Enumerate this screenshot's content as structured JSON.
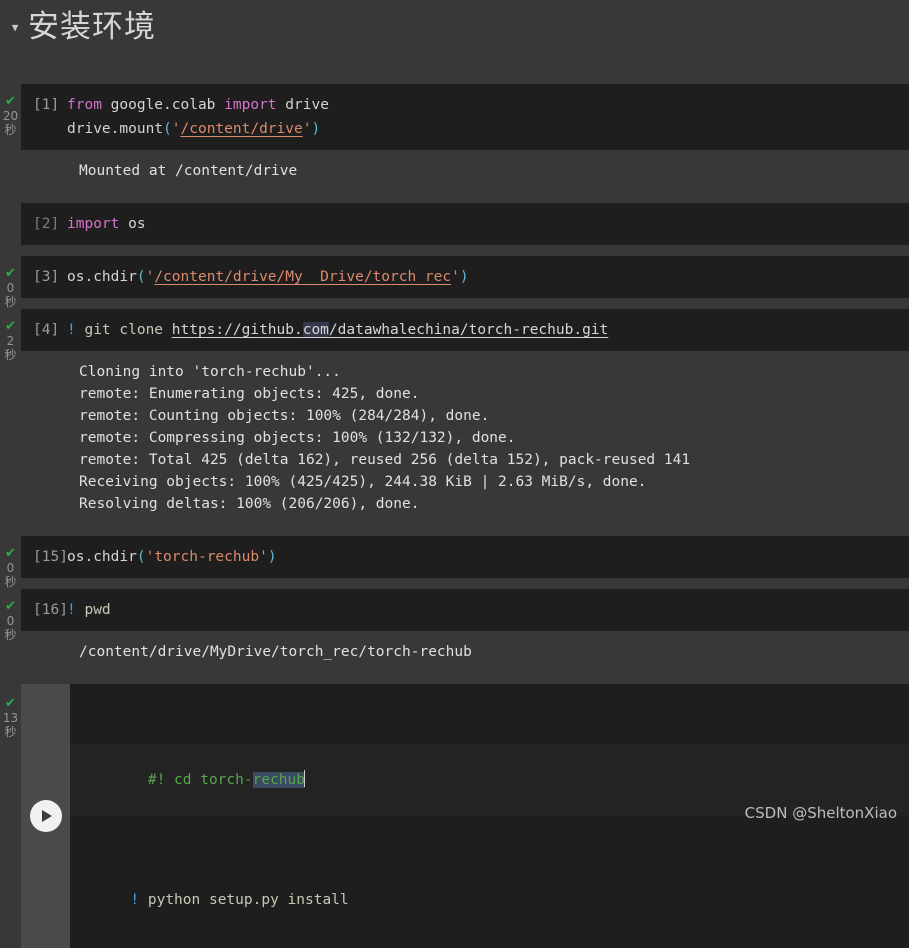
{
  "section": {
    "title": "安装环境",
    "caret": "▼"
  },
  "gutter": {
    "check_glyph": "✔",
    "unit": "秒"
  },
  "cells": [
    {
      "prompt": "[1]",
      "status": "done",
      "time_value": "20",
      "lines": [
        {
          "tokens": [
            {
              "t": "from",
              "c": "tok-kw"
            },
            {
              "t": " ",
              "c": "tok-plain"
            },
            {
              "t": "google.colab",
              "c": "tok-plain"
            },
            {
              "t": " ",
              "c": "tok-plain"
            },
            {
              "t": "import",
              "c": "tok-kw"
            },
            {
              "t": " ",
              "c": "tok-plain"
            },
            {
              "t": "drive",
              "c": "tok-plain"
            }
          ]
        },
        {
          "tokens": [
            {
              "t": "drive.mount",
              "c": "tok-fn"
            },
            {
              "t": "(",
              "c": "tok-punc"
            },
            {
              "t": "'",
              "c": "tok-str"
            },
            {
              "t": "/content/drive",
              "c": "tok-str-link"
            },
            {
              "t": "'",
              "c": "tok-str"
            },
            {
              "t": ")",
              "c": "tok-punc"
            }
          ]
        }
      ],
      "output": [
        "Mounted at /content/drive"
      ]
    },
    {
      "prompt": "[2]",
      "status": "none",
      "time_value": "",
      "lines": [
        {
          "tokens": [
            {
              "t": "import",
              "c": "tok-kw"
            },
            {
              "t": " ",
              "c": "tok-plain"
            },
            {
              "t": "os",
              "c": "tok-plain"
            }
          ]
        }
      ],
      "output": []
    },
    {
      "prompt": "[3]",
      "status": "done",
      "time_value": "0",
      "lines": [
        {
          "tokens": [
            {
              "t": "os.chdir",
              "c": "tok-fn"
            },
            {
              "t": "(",
              "c": "tok-punc"
            },
            {
              "t": "'",
              "c": "tok-str"
            },
            {
              "t": "/content/drive/My  Drive/torch_rec",
              "c": "tok-str-link"
            },
            {
              "t": "'",
              "c": "tok-str"
            },
            {
              "t": ")",
              "c": "tok-punc"
            }
          ]
        }
      ],
      "output": []
    },
    {
      "prompt": "[4]",
      "status": "done",
      "time_value": "2",
      "lines": [
        {
          "tokens": [
            {
              "t": "!",
              "c": "tok-bang"
            },
            {
              "t": " git clone ",
              "c": "tok-name"
            },
            {
              "t": "https://github.",
              "c": "tok-link"
            },
            {
              "t": "com",
              "c": "tok-link hl-soft"
            },
            {
              "t": "/datawhalechina/torch-rechub.git",
              "c": "tok-link"
            }
          ]
        }
      ],
      "output": [
        "Cloning into 'torch-rechub'...",
        "remote: Enumerating objects: 425, done.",
        "remote: Counting objects: 100% (284/284), done.",
        "remote: Compressing objects: 100% (132/132), done.",
        "remote: Total 425 (delta 162), reused 256 (delta 152), pack-reused 141",
        "Receiving objects: 100% (425/425), 244.38 KiB | 2.63 MiB/s, done.",
        "Resolving deltas: 100% (206/206), done."
      ]
    },
    {
      "prompt": "[15]",
      "status": "done",
      "time_value": "0",
      "lines": [
        {
          "tokens": [
            {
              "t": "os.chdir",
              "c": "tok-fn"
            },
            {
              "t": "(",
              "c": "tok-punc"
            },
            {
              "t": "'",
              "c": "tok-str"
            },
            {
              "t": "torch-rechub",
              "c": "tok-str"
            },
            {
              "t": "'",
              "c": "tok-str"
            },
            {
              "t": ")",
              "c": "tok-punc"
            }
          ]
        }
      ],
      "output": []
    },
    {
      "prompt": "[16]",
      "status": "done",
      "time_value": "0",
      "lines": [
        {
          "tokens": [
            {
              "t": "!",
              "c": "tok-bang"
            },
            {
              "t": " pwd",
              "c": "tok-name"
            }
          ]
        }
      ],
      "output": [
        "/content/drive/MyDrive/torch_rec/torch-rechub"
      ]
    }
  ],
  "active_cell": {
    "status": "done",
    "time_value": "13",
    "run_button_label": "run-cell",
    "line1": {
      "prefix": "#! cd torch-",
      "selected": "rechub"
    },
    "line2": {
      "bang": "!",
      "rest": " python setup.py install"
    }
  },
  "watermark": "CSDN @SheltonXiao",
  "colors": {
    "page_bg": "#383838",
    "code_bg": "#1e1e1e",
    "accent_green": "#27b04b",
    "keyword": "#d473c8",
    "string": "#dd8a6a",
    "comment": "#56a64a",
    "bang": "#4a9fe0"
  }
}
